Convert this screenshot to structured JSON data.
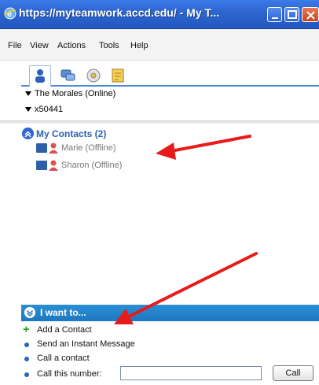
{
  "window": {
    "title": "https://myteamwork.accd.edu/ - My T...",
    "icon": "browser-e-icon"
  },
  "menu": {
    "items": [
      "File",
      "View",
      "Actions",
      "Tools",
      "Help"
    ]
  },
  "toolbar": {
    "tabs": [
      "contacts-tab-icon",
      "chat-tab-icon",
      "cd-tab-icon",
      "notes-tab-icon"
    ],
    "active_tab": 0
  },
  "status_tree": {
    "rows": [
      "The Morales (Online)",
      "x50441"
    ]
  },
  "contacts": {
    "group_label": "My Contacts (2)",
    "items": [
      {
        "label": "Marie (Offline)"
      },
      {
        "label": "Sharon (Offline)"
      }
    ]
  },
  "iwant": {
    "header": "I want to...",
    "actions": [
      "Add a Contact",
      "Send an Instant Message",
      "Call a contact",
      "Call this number:"
    ],
    "call_button": "Call",
    "call_input_value": ""
  },
  "colors": {
    "titlebar": "#2f66d0",
    "accent": "#2962b3",
    "annotation_arrow": "#e81b1b"
  }
}
